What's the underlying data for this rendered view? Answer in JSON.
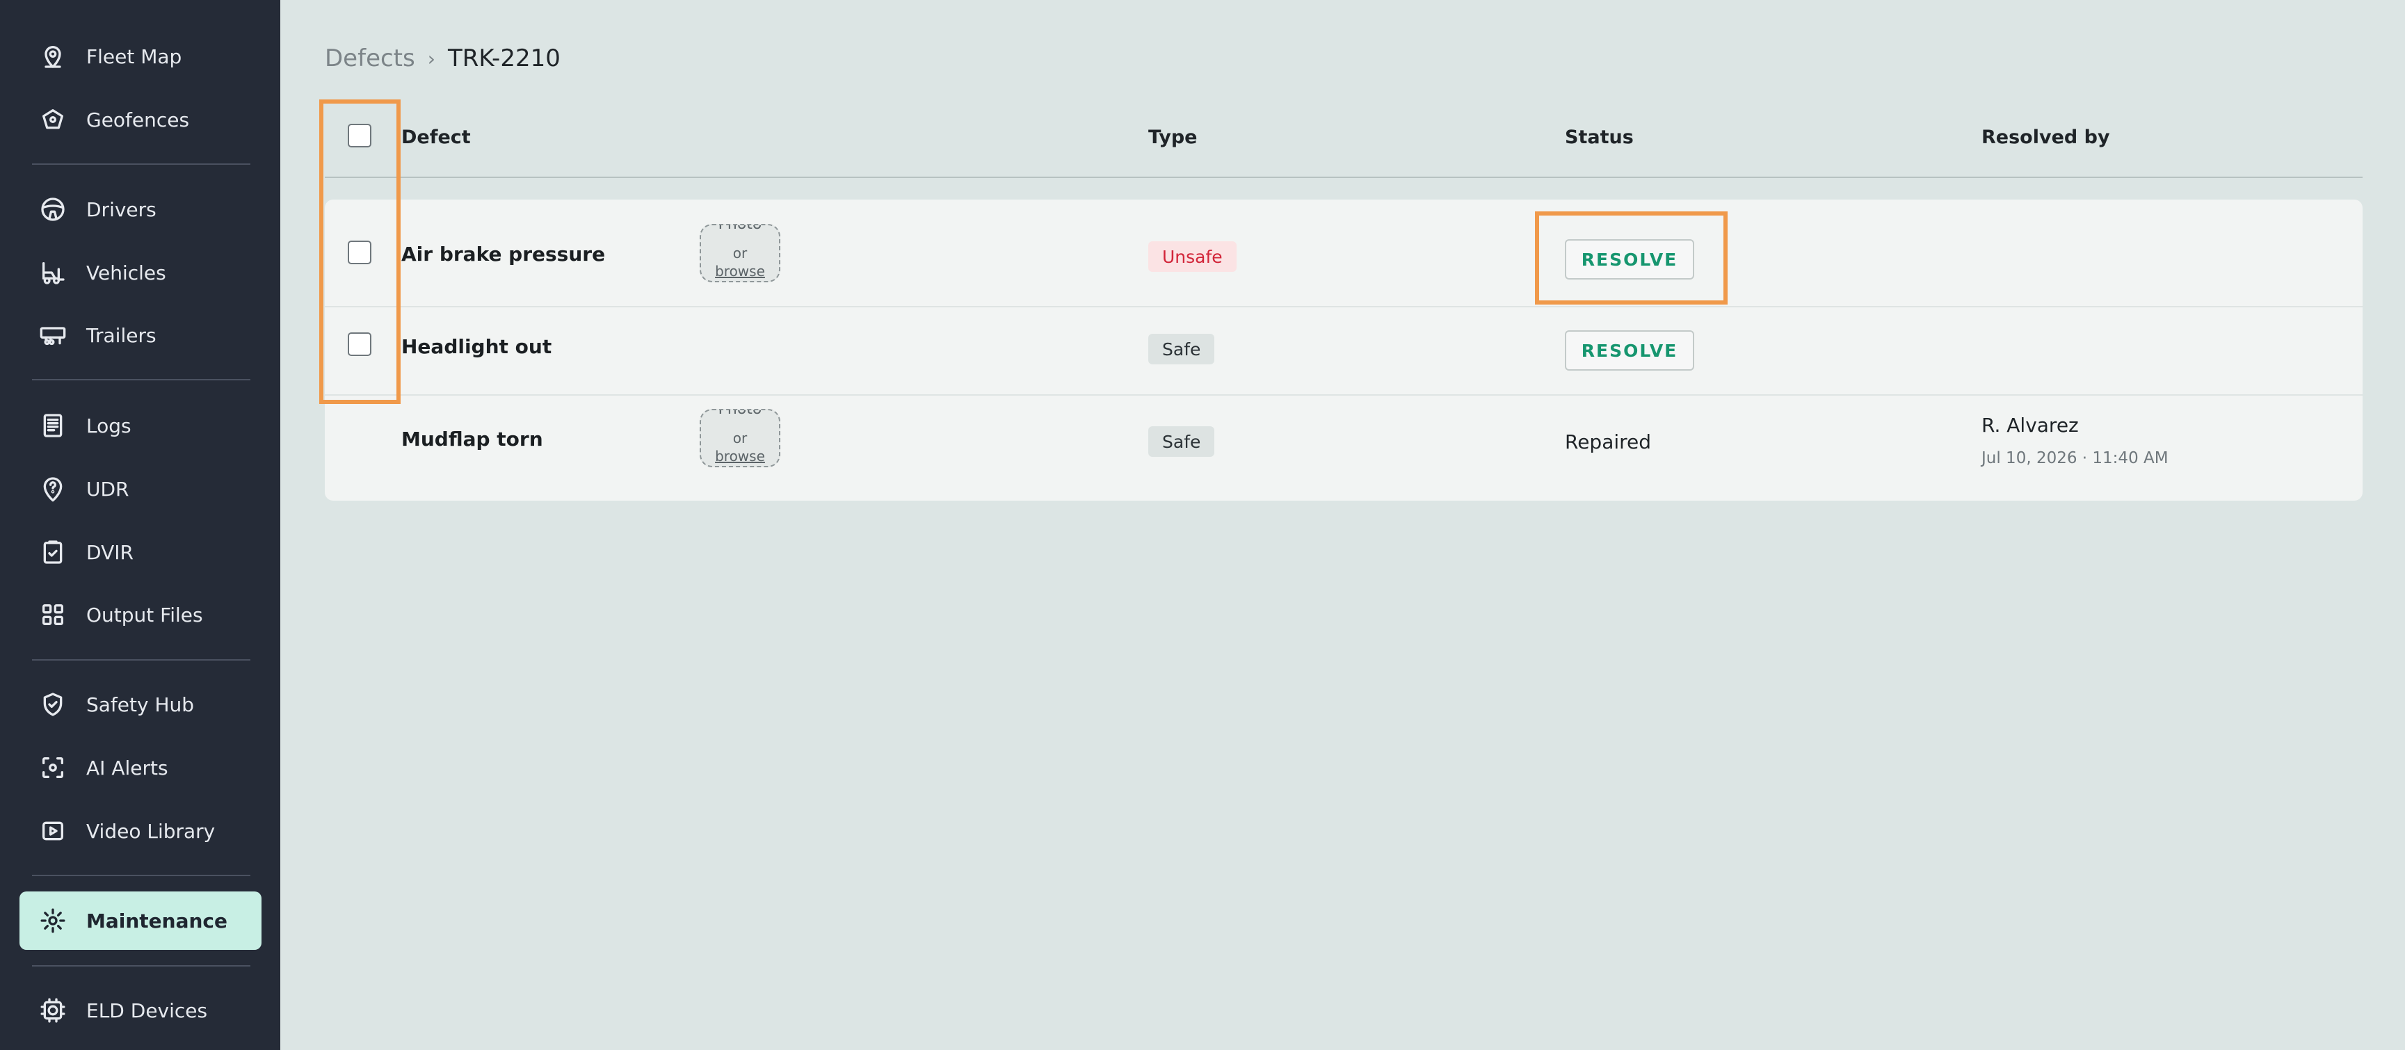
{
  "sidebar": {
    "items": [
      {
        "label": "Fleet Map",
        "icon": "map-pin-icon"
      },
      {
        "label": "Geofences",
        "icon": "geofence-icon"
      },
      {
        "label": "Drivers",
        "icon": "steering-wheel-icon"
      },
      {
        "label": "Vehicles",
        "icon": "forklift-icon"
      },
      {
        "label": "Trailers",
        "icon": "trailer-icon"
      },
      {
        "label": "Logs",
        "icon": "log-sheet-icon"
      },
      {
        "label": "UDR",
        "icon": "question-pin-icon"
      },
      {
        "label": "DVIR",
        "icon": "clipboard-check-icon"
      },
      {
        "label": "Output Files",
        "icon": "grid-icon"
      },
      {
        "label": "Safety Hub",
        "icon": "shield-check-icon"
      },
      {
        "label": "AI Alerts",
        "icon": "scan-icon"
      },
      {
        "label": "Video Library",
        "icon": "play-icon"
      },
      {
        "label": "Maintenance",
        "icon": "gear-wrench-icon",
        "active": true
      },
      {
        "label": "ELD Devices",
        "icon": "device-icon"
      }
    ]
  },
  "breadcrumb": {
    "parent": "Defects",
    "separator": "›",
    "current": "TRK-2210"
  },
  "table": {
    "headers": {
      "defect": "Defect",
      "type": "Type",
      "status": "Status",
      "resolved_by": "Resolved by"
    },
    "rows": [
      {
        "defect": "Air brake pressure",
        "photo": {
          "top": "Photo",
          "or": "or",
          "browse": "browse"
        },
        "type": "Unsafe",
        "status_action": "RESOLVE"
      },
      {
        "defect": "Headlight out",
        "type": "Safe",
        "status_action": "RESOLVE"
      },
      {
        "defect": "Mudflap torn",
        "photo": {
          "top": "Photo",
          "or": "or",
          "browse": "browse"
        },
        "type": "Safe",
        "status": "Repaired",
        "resolved_by": "R. Alvarez",
        "resolved_at": "Jul 10, 2026 · 11:40 AM"
      }
    ]
  },
  "colors": {
    "accent": "#16966f",
    "unsafe": "#d2263a",
    "sidebar_bg": "#252b37",
    "active_item_bg": "#c8efe4",
    "highlight": "#f0994a"
  }
}
